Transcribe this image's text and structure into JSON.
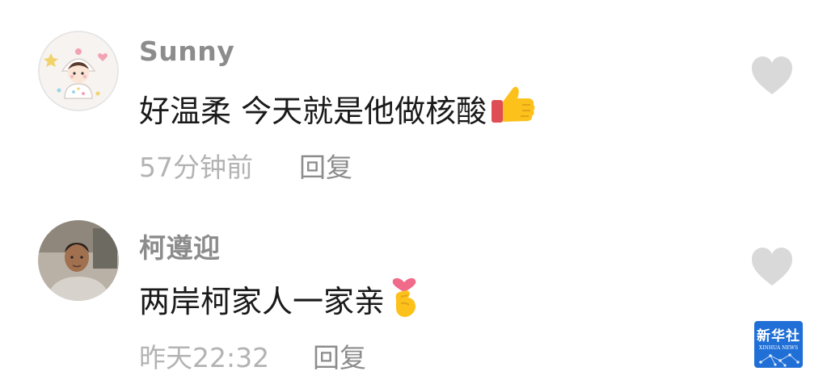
{
  "comments": [
    {
      "username": "Sunny",
      "text": "好温柔 今天就是他做核酸",
      "emoji": "thumbs-up-icon",
      "time": "57分钟前",
      "reply_label": "回复"
    },
    {
      "username": "柯遵迎",
      "text": "两岸柯家人一家亲",
      "emoji": "finger-heart-icon",
      "time": "昨天22:32",
      "reply_label": "回复"
    }
  ],
  "watermark": {
    "name_cn": "新华社",
    "name_en": "XINHUA NEWS"
  },
  "colors": {
    "username": "#8c8c8c",
    "text": "#1a1a1a",
    "meta": "#b3b3b3",
    "like": "#d9d9d9",
    "logo_bg": "#1f6fd6"
  }
}
